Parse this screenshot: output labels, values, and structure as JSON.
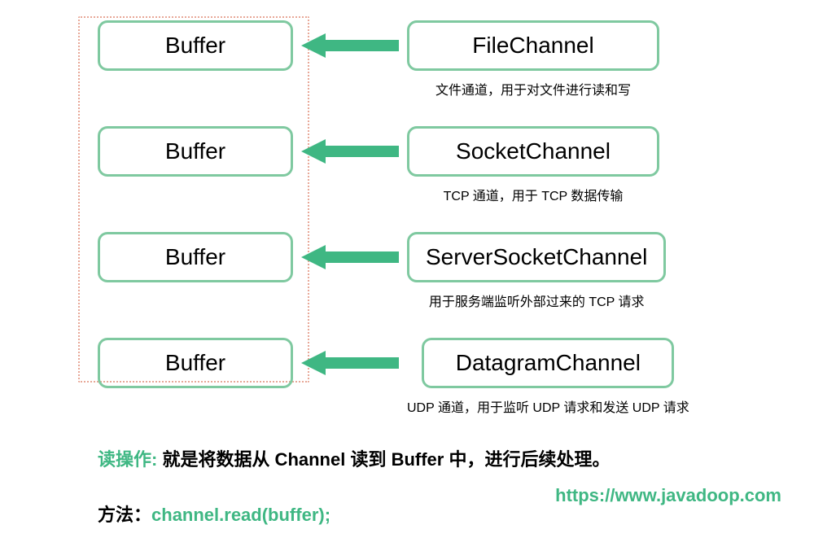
{
  "rows": [
    {
      "buffer": "Buffer",
      "channel": "FileChannel",
      "desc": "文件通道，用于对文件进行读和写"
    },
    {
      "buffer": "Buffer",
      "channel": "SocketChannel",
      "desc": "TCP 通道，用于 TCP 数据传输"
    },
    {
      "buffer": "Buffer",
      "channel": "ServerSocketChannel",
      "desc": "用于服务端监听外部过来的 TCP 请求"
    },
    {
      "buffer": "Buffer",
      "channel": "DatagramChannel",
      "desc": "UDP 通道，用于监听 UDP 请求和发送 UDP 请求"
    }
  ],
  "readOp": {
    "label": "读操作:",
    "text": " 就是将数据从 Channel 读到 Buffer 中，进行后续处理。"
  },
  "method": {
    "label": "方法：",
    "code": "channel.read(buffer);"
  },
  "url": "https://www.javadoop.com"
}
